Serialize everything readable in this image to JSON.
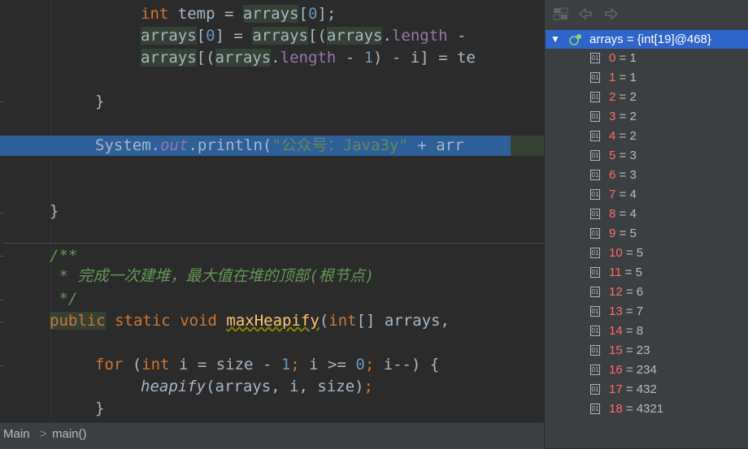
{
  "editor": {
    "lines": {
      "l1": {
        "kw": "int",
        "a": " temp = ",
        "arr": "arrays",
        "b": "[",
        "n": "0",
        "c": "];"
      },
      "l2": {
        "arr1": "arrays",
        "b1": "[",
        "n1": "0",
        "b2": "] = ",
        "arr2": "arrays",
        "b3": "[(",
        "arr3": "arrays",
        "dot": ".",
        "fld": "length",
        "rest": " -"
      },
      "l3": {
        "arr1": "arrays",
        "b1": "[(",
        "arr2": "arrays",
        "dot": ".",
        "fld": "length",
        "a": " - ",
        "n": "1",
        "b": ") - i] = te"
      },
      "l4": {
        "t": "}"
      },
      "l5": {
        "a": "System.",
        "out": "out",
        "b": ".println(",
        "s": "\"公众号：Java3y\"",
        "c": " + ",
        "d": "arr"
      },
      "l6": {
        "t": "}"
      },
      "l7": {
        "t": "/**"
      },
      "l8": {
        "t": " * 完成一次建堆，最大值在堆的顶部(根节点)"
      },
      "l9": {
        "t": " */"
      },
      "l10": {
        "pub": "public",
        "sp1": " ",
        "st": "static",
        "sp2": " ",
        "vd": "void",
        "sp3": " ",
        "fn": "maxHeapify",
        "p": "(",
        "intk": "int",
        "rest": "[] arrays,"
      },
      "l11": {
        "fork": "for",
        "a": " (",
        "intk": "int",
        "b": " i = size - ",
        "n1": "1",
        "semi1": "; ",
        "c": "i >= ",
        "n2": "0",
        "semi2": "; ",
        "d": "i--) {"
      },
      "l12": {
        "fn": "heapify",
        "a": "(arrays, i, size)",
        "semi": ";"
      },
      "l13": {
        "t": "}"
      }
    }
  },
  "breadcrumb": {
    "class_name": "Main",
    "sep": ">",
    "method": "main()"
  },
  "debug": {
    "toolbar_icons": [
      "restore-layout-icon",
      "back-arrow-icon",
      "forward-arrow-icon"
    ],
    "root": {
      "arrow": "▼",
      "label": "arrays = {int[19]@468}"
    },
    "items": [
      {
        "index": "0",
        "value": " = 1"
      },
      {
        "index": "1",
        "value": " = 1"
      },
      {
        "index": "2",
        "value": " = 2"
      },
      {
        "index": "3",
        "value": " = 2"
      },
      {
        "index": "4",
        "value": " = 2"
      },
      {
        "index": "5",
        "value": " = 3"
      },
      {
        "index": "6",
        "value": " = 3"
      },
      {
        "index": "7",
        "value": " = 4"
      },
      {
        "index": "8",
        "value": " = 4"
      },
      {
        "index": "9",
        "value": " = 5"
      },
      {
        "index": "10",
        "value": " = 5"
      },
      {
        "index": "11",
        "value": " = 5"
      },
      {
        "index": "12",
        "value": " = 6"
      },
      {
        "index": "13",
        "value": " = 7"
      },
      {
        "index": "14",
        "value": " = 8"
      },
      {
        "index": "15",
        "value": " = 23"
      },
      {
        "index": "16",
        "value": " = 234"
      },
      {
        "index": "17",
        "value": " = 432"
      },
      {
        "index": "18",
        "value": " = 4321"
      }
    ]
  },
  "colors": {
    "execution_line": "#2d6099",
    "selected_row": "#2f65ca",
    "index_red": "#ff6b68",
    "keyword": "#cc7832",
    "number": "#6897bb"
  }
}
